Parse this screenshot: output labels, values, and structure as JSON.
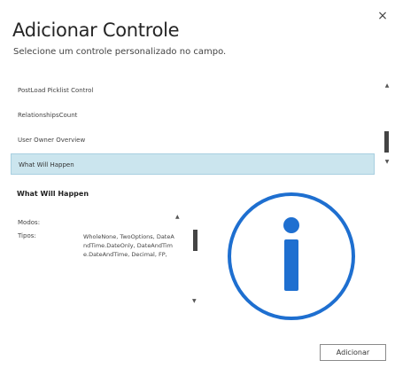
{
  "dialog": {
    "close_glyph": "×",
    "title": "Adicionar Controle",
    "subtitle": "Selecione um controle personalizado no campo."
  },
  "list": {
    "items": [
      {
        "label": "PostLoad Picklist Control",
        "selected": false
      },
      {
        "label": "RelationshipsCount",
        "selected": false
      },
      {
        "label": "User Owner Overview",
        "selected": false
      },
      {
        "label": "What Will Happen",
        "selected": true
      }
    ]
  },
  "detail": {
    "title": "What Will Happen",
    "modes_label": "Modos:",
    "modes_value": "",
    "types_label": "Tipos:",
    "types_value": "WholeNone, TwoOptions, DateAndTime.DateOnly, DateAndTime.DateAndTime, Decimal, FP,",
    "icon": "info-icon"
  },
  "footer": {
    "add_label": "Adicionar"
  },
  "colors": {
    "selected_bg": "#cbe5ee",
    "info_blue": "#1e6fd0"
  }
}
